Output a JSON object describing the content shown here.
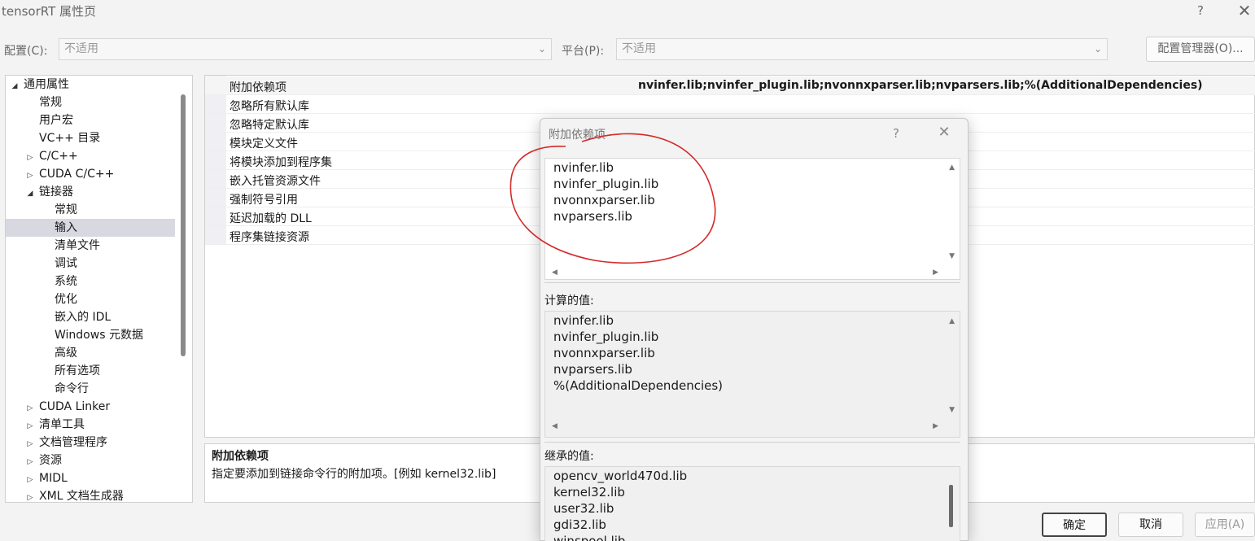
{
  "window": {
    "title": "tensorRT 属性页",
    "help": "?",
    "close": "✕"
  },
  "config": {
    "config_label": "配置(C):",
    "config_value": "不适用",
    "platform_label": "平台(P):",
    "platform_value": "不适用",
    "manager_button": "配置管理器(O)..."
  },
  "tree": {
    "items": [
      {
        "label": "通用属性",
        "indent": 0,
        "expander": "open"
      },
      {
        "label": "常规",
        "indent": 1,
        "expander": "none"
      },
      {
        "label": "用户宏",
        "indent": 1,
        "expander": "none"
      },
      {
        "label": "VC++ 目录",
        "indent": 1,
        "expander": "none"
      },
      {
        "label": "C/C++",
        "indent": 1,
        "expander": "closed"
      },
      {
        "label": "CUDA C/C++",
        "indent": 1,
        "expander": "closed"
      },
      {
        "label": "链接器",
        "indent": 1,
        "expander": "open"
      },
      {
        "label": "常规",
        "indent": 2,
        "expander": "none"
      },
      {
        "label": "输入",
        "indent": 2,
        "expander": "none",
        "selected": true
      },
      {
        "label": "清单文件",
        "indent": 2,
        "expander": "none"
      },
      {
        "label": "调试",
        "indent": 2,
        "expander": "none"
      },
      {
        "label": "系统",
        "indent": 2,
        "expander": "none"
      },
      {
        "label": "优化",
        "indent": 2,
        "expander": "none"
      },
      {
        "label": "嵌入的 IDL",
        "indent": 2,
        "expander": "none"
      },
      {
        "label": "Windows 元数据",
        "indent": 2,
        "expander": "none"
      },
      {
        "label": "高级",
        "indent": 2,
        "expander": "none"
      },
      {
        "label": "所有选项",
        "indent": 2,
        "expander": "none"
      },
      {
        "label": "命令行",
        "indent": 2,
        "expander": "none"
      },
      {
        "label": "CUDA Linker",
        "indent": 1,
        "expander": "closed"
      },
      {
        "label": "清单工具",
        "indent": 1,
        "expander": "closed"
      },
      {
        "label": "文档管理程序",
        "indent": 1,
        "expander": "closed"
      },
      {
        "label": "资源",
        "indent": 1,
        "expander": "closed"
      },
      {
        "label": "MIDL",
        "indent": 1,
        "expander": "closed"
      },
      {
        "label": "XML 文档生成器",
        "indent": 1,
        "expander": "closed"
      }
    ]
  },
  "properties": {
    "rows": [
      {
        "name": "附加依赖项",
        "value": "nvinfer.lib;nvinfer_plugin.lib;nvonnxparser.lib;nvparsers.lib;%(AdditionalDependencies)"
      },
      {
        "name": "忽略所有默认库",
        "value": ""
      },
      {
        "name": "忽略特定默认库",
        "value": ""
      },
      {
        "name": "模块定义文件",
        "value": ""
      },
      {
        "name": "将模块添加到程序集",
        "value": ""
      },
      {
        "name": "嵌入托管资源文件",
        "value": ""
      },
      {
        "name": "强制符号引用",
        "value": ""
      },
      {
        "name": "延迟加载的 DLL",
        "value": ""
      },
      {
        "name": "程序集链接资源",
        "value": ""
      }
    ]
  },
  "description": {
    "title": "附加依赖项",
    "text": "指定要添加到链接命令行的附加项。[例如 kernel32.lib]"
  },
  "buttons": {
    "ok": "确定",
    "cancel": "取消",
    "apply": "应用(A)"
  },
  "dialog": {
    "title": "附加依赖项",
    "help": "?",
    "close": "✕",
    "editable_lines": [
      "nvinfer.lib",
      "nvinfer_plugin.lib",
      "nvonnxparser.lib",
      "nvparsers.lib"
    ],
    "computed_label": "计算的值:",
    "computed_lines": [
      "nvinfer.lib",
      "nvinfer_plugin.lib",
      "nvonnxparser.lib",
      "nvparsers.lib",
      "%(AdditionalDependencies)"
    ],
    "inherited_label": "继承的值:",
    "inherited_lines": [
      "opencv_world470d.lib",
      "kernel32.lib",
      "user32.lib",
      "gdi32.lib",
      "winspool.lib"
    ]
  },
  "annotation_color": "#d42a2a"
}
